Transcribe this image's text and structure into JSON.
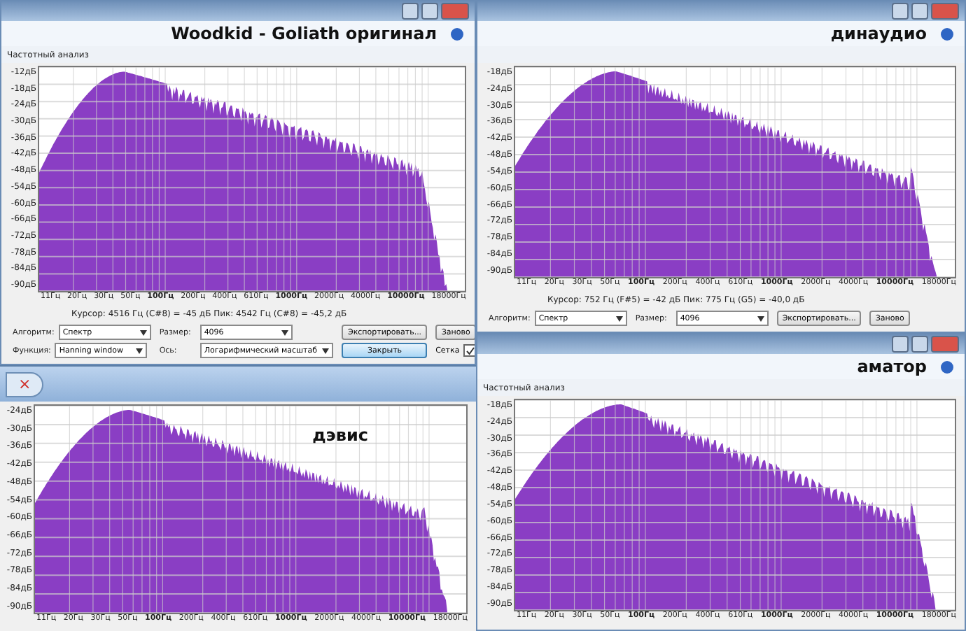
{
  "windows": [
    {
      "kind": "analysis",
      "title": "Woodkid - Goliath оригинал",
      "caption": "Частотный анализ",
      "y_ticks": [
        "-12дБ",
        "-18дБ",
        "-24дБ",
        "-30дБ",
        "-36дБ",
        "-42дБ",
        "-48дБ",
        "-54дБ",
        "-60дБ",
        "-66дБ",
        "-72дБ",
        "-78дБ",
        "-84дБ",
        "-90дБ"
      ],
      "x_ticks": [
        {
          "label": "11Гц",
          "major": false
        },
        {
          "label": "20Гц",
          "major": false
        },
        {
          "label": "30Гц",
          "major": false
        },
        {
          "label": "50Гц",
          "major": false
        },
        {
          "label": "100Гц",
          "major": true
        },
        {
          "label": "200Гц",
          "major": false
        },
        {
          "label": "400Гц",
          "major": false
        },
        {
          "label": "610Гц",
          "major": false
        },
        {
          "label": "1000Гц",
          "major": true
        },
        {
          "label": "2000Гц",
          "major": false
        },
        {
          "label": "4000Гц",
          "major": false
        },
        {
          "label": "10000Гц",
          "major": true
        },
        {
          "label": "18000Гц",
          "major": false
        }
      ],
      "cursor": "Курсор: 4516 Гц (C#8) = -45 дБ   Пик: 4542 Гц (C#8) = -45,2 дБ",
      "control_rows": [
        [
          {
            "kind": "select",
            "label": "Алгоритм:",
            "value": "Спектр"
          },
          {
            "kind": "select",
            "label": "Размер:",
            "value": "4096"
          },
          {
            "kind": "button",
            "label": "Экспортировать...",
            "focused": false
          },
          {
            "kind": "button",
            "label": "Заново",
            "focused": false
          }
        ],
        [
          {
            "kind": "select",
            "label": "Функция:",
            "value": "Hanning window"
          },
          {
            "kind": "select",
            "label": "Ось:",
            "value": "Логарифмический масштаб"
          },
          {
            "kind": "button",
            "label": "Закрыть",
            "focused": true
          },
          {
            "kind": "checkbox",
            "label": "Сетка",
            "checked": true
          }
        ]
      ]
    },
    {
      "kind": "taskbar",
      "close_label": "×"
    },
    {
      "kind": "plot",
      "title": "дэвис",
      "y_ticks": [
        "-24дБ",
        "-30дБ",
        "-36дБ",
        "-42дБ",
        "-48дБ",
        "-54дБ",
        "-60дБ",
        "-66дБ",
        "-72дБ",
        "-78дБ",
        "-84дБ",
        "-90дБ"
      ],
      "x_ticks": [
        {
          "label": "11Гц",
          "major": false
        },
        {
          "label": "20Гц",
          "major": false
        },
        {
          "label": "30Гц",
          "major": false
        },
        {
          "label": "50Гц",
          "major": false
        },
        {
          "label": "100Гц",
          "major": true
        },
        {
          "label": "200Гц",
          "major": false
        },
        {
          "label": "400Гц",
          "major": false
        },
        {
          "label": "610Гц",
          "major": false
        },
        {
          "label": "1000Гц",
          "major": true
        },
        {
          "label": "2000Гц",
          "major": false
        },
        {
          "label": "4000Гц",
          "major": false
        },
        {
          "label": "10000Гц",
          "major": true
        },
        {
          "label": "18000Гц",
          "major": false
        }
      ]
    },
    {
      "kind": "analysis",
      "title": "динаудио",
      "y_ticks": [
        "-18дБ",
        "-24дБ",
        "-30дБ",
        "-36дБ",
        "-42дБ",
        "-48дБ",
        "-54дБ",
        "-60дБ",
        "-66дБ",
        "-72дБ",
        "-78дБ",
        "-84дБ",
        "-90дБ"
      ],
      "x_ticks": [
        {
          "label": "11Гц",
          "major": false
        },
        {
          "label": "20Гц",
          "major": false
        },
        {
          "label": "30Гц",
          "major": false
        },
        {
          "label": "50Гц",
          "major": false
        },
        {
          "label": "100Гц",
          "major": true
        },
        {
          "label": "200Гц",
          "major": false
        },
        {
          "label": "400Гц",
          "major": false
        },
        {
          "label": "610Гц",
          "major": false
        },
        {
          "label": "1000Гц",
          "major": true
        },
        {
          "label": "2000Гц",
          "major": false
        },
        {
          "label": "4000Гц",
          "major": false
        },
        {
          "label": "10000Гц",
          "major": true
        },
        {
          "label": "18000Гц",
          "major": false
        }
      ],
      "cursor": "Курсор: 752 Гц (F#5) = -42 дБ   Пик: 775 Гц (G5) = -40,0 дБ",
      "control_rows": [
        [
          {
            "kind": "select",
            "label": "Алгоритм:",
            "value": "Спектр"
          },
          {
            "kind": "select",
            "label": "Размер:",
            "value": "4096"
          },
          {
            "kind": "button",
            "label": "Экспортировать...",
            "focused": false
          },
          {
            "kind": "button",
            "label": "Заново",
            "focused": false
          }
        ]
      ]
    },
    {
      "kind": "analysis",
      "title": "аматор",
      "caption": "Частотный анализ",
      "y_ticks": [
        "-18дБ",
        "-24дБ",
        "-30дБ",
        "-36дБ",
        "-42дБ",
        "-48дБ",
        "-54дБ",
        "-60дБ",
        "-66дБ",
        "-72дБ",
        "-78дБ",
        "-84дБ",
        "-90дБ"
      ],
      "x_ticks": [
        {
          "label": "11Гц",
          "major": false
        },
        {
          "label": "20Гц",
          "major": false
        },
        {
          "label": "30Гц",
          "major": false
        },
        {
          "label": "50Гц",
          "major": false
        },
        {
          "label": "100Гц",
          "major": true
        },
        {
          "label": "200Гц",
          "major": false
        },
        {
          "label": "400Гц",
          "major": false
        },
        {
          "label": "610Гц",
          "major": false
        },
        {
          "label": "1000Гц",
          "major": true
        },
        {
          "label": "2000Гц",
          "major": false
        },
        {
          "label": "4000Гц",
          "major": false
        },
        {
          "label": "10000Гц",
          "major": true
        },
        {
          "label": "18000Гц",
          "major": false
        }
      ]
    }
  ]
}
